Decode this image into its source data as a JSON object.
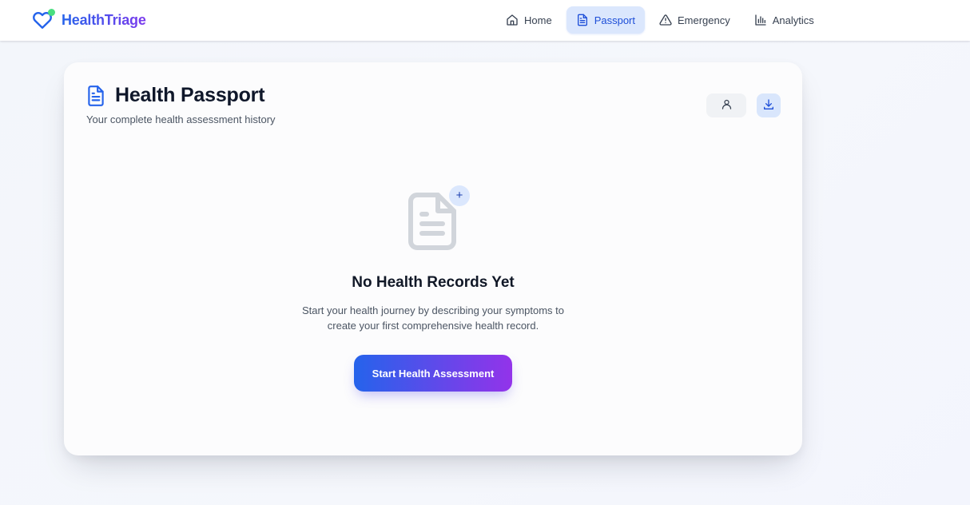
{
  "brand": {
    "name": "HealthTriage",
    "logo_icon": "heart-icon",
    "status_dot_color": "#4ade80"
  },
  "nav": {
    "items": [
      {
        "label": "Home",
        "icon": "home-icon",
        "active": false
      },
      {
        "label": "Passport",
        "icon": "document-icon",
        "active": true
      },
      {
        "label": "Emergency",
        "icon": "warning-triangle-icon",
        "active": false
      },
      {
        "label": "Analytics",
        "icon": "bar-chart-icon",
        "active": false
      }
    ]
  },
  "passport": {
    "title": "Health Passport",
    "subtitle": "Your complete health assessment history",
    "actions": [
      {
        "icon": "user-icon"
      },
      {
        "icon": "download-icon"
      }
    ]
  },
  "empty_state": {
    "icon": "document-icon",
    "badge_symbol": "+",
    "title": "No Health Records Yet",
    "message": "Start your health journey by describing your symptoms to create your first comprehensive health record.",
    "cta_label": "Start Health Assessment"
  },
  "colors": {
    "primary": "#2563eb",
    "accent": "#9333ea",
    "active_nav_bg": "#dbe7fd"
  }
}
